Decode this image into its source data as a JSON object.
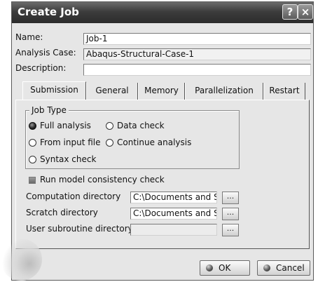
{
  "window": {
    "title": "Create Job",
    "help_label": "?",
    "close_label": "×"
  },
  "form": {
    "name_label": "Name:",
    "name_value": "Job-1",
    "analysis_case_label": "Analysis Case:",
    "analysis_case_value": "Abaqus-Structural-Case-1",
    "description_label": "Description:",
    "description_value": ""
  },
  "tabs": [
    {
      "label": "Submission",
      "active": true
    },
    {
      "label": "General",
      "active": false
    },
    {
      "label": "Memory",
      "active": false
    },
    {
      "label": "Parallelization",
      "active": false
    },
    {
      "label": "Restart",
      "active": false
    }
  ],
  "job_type": {
    "legend": "Job Type",
    "options": [
      {
        "label": "Full analysis",
        "checked": true
      },
      {
        "label": "Data check",
        "checked": false
      },
      {
        "label": "From input file",
        "checked": false
      },
      {
        "label": "Continue analysis",
        "checked": false
      },
      {
        "label": "Syntax check",
        "checked": false
      }
    ]
  },
  "consistency_check": {
    "label": "Run model consistency check",
    "checked": true
  },
  "directories": {
    "computation_label": "Computation directory",
    "computation_value": "C:\\Documents and S",
    "scratch_label": "Scratch directory",
    "scratch_value": "C:\\Documents and S",
    "user_subroutine_label": "User subroutine directory",
    "user_subroutine_value": "",
    "browse_label": "..."
  },
  "buttons": {
    "ok_label": "OK",
    "cancel_label": "Cancel"
  }
}
